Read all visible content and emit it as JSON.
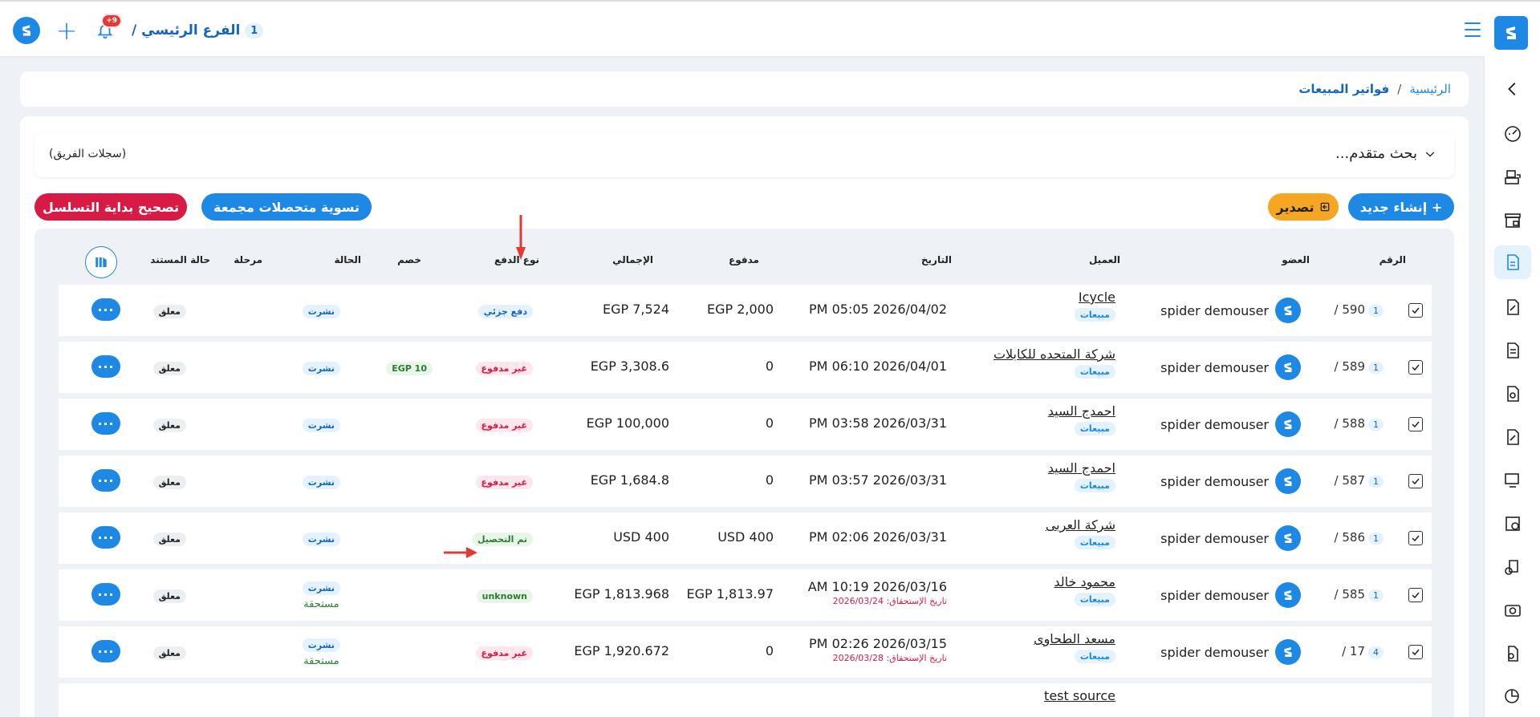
{
  "topbar": {
    "branch_name": "الفرع الرئيسي /",
    "branch_number": "1",
    "notif_count": "+9"
  },
  "breadcrumb": {
    "home": "الرئيسية",
    "separator": "/",
    "current": "فواتير المبيعات"
  },
  "search": {
    "advanced_label": "بحث متقدم...",
    "team_label": "(سجلات الفريق)"
  },
  "toolbar": {
    "create_label": "+ إنشاء جديد",
    "export_label": "تصدير",
    "settle_label": "تسوية متحصلات مجمعة",
    "fix_label": "تصحيح بداية التسلسل"
  },
  "columns": {
    "number": "الرقم",
    "member": "العضو",
    "client": "العميل",
    "date": "التاريخ",
    "paid": "مدفوع",
    "total": "الإجمالي",
    "payment_type": "نوع الدفع",
    "discount": "خصم",
    "status": "الحالة",
    "stage": "مرحلة",
    "doc_status": "حالة المستند"
  },
  "rows": [
    {
      "num": "590 /",
      "branch": "1",
      "member": "spider demouser",
      "client": "Icycle",
      "client_tag": "مبيعات",
      "date": "2026/04/02 05:05 PM",
      "due": "",
      "paid": "EGP 2,000",
      "total": "EGP 7,524",
      "pay_type": "دفع جزئي",
      "pay_class": "pill-partial",
      "discount": "",
      "status": "نشرت",
      "status_due": "",
      "doc_status": "معلق",
      "more": "···"
    },
    {
      "num": "589 /",
      "branch": "1",
      "member": "spider demouser",
      "client": "شركة المتحده للكابلات",
      "client_tag": "مبيعات",
      "date": "2026/04/01 06:10 PM",
      "due": "",
      "paid": "0",
      "total": "EGP 3,308.6",
      "pay_type": "غير مدفوع",
      "pay_class": "pill-unpaid",
      "discount": "EGP 10",
      "status": "نشرت",
      "status_due": "",
      "doc_status": "معلق",
      "more": "···"
    },
    {
      "num": "588 /",
      "branch": "1",
      "member": "spider demouser",
      "client": "احمدج السيد",
      "client_tag": "مبيعات",
      "date": "2026/03/31 03:58 PM",
      "due": "",
      "paid": "0",
      "total": "EGP 100,000",
      "pay_type": "غير مدفوع",
      "pay_class": "pill-unpaid",
      "discount": "",
      "status": "نشرت",
      "status_due": "",
      "doc_status": "معلق",
      "more": "···"
    },
    {
      "num": "587 /",
      "branch": "1",
      "member": "spider demouser",
      "client": "احمدج السيد",
      "client_tag": "مبيعات",
      "date": "2026/03/31 03:57 PM",
      "due": "",
      "paid": "0",
      "total": "EGP 1,684.8",
      "pay_type": "غير مدفوع",
      "pay_class": "pill-unpaid",
      "discount": "",
      "status": "نشرت",
      "status_due": "",
      "doc_status": "معلق",
      "more": "···"
    },
    {
      "num": "586 /",
      "branch": "1",
      "member": "spider demouser",
      "client": "شركة العربى",
      "client_tag": "مبيعات",
      "date": "2026/03/31 02:06 PM",
      "due": "",
      "paid": "USD 400",
      "total": "USD 400",
      "pay_type": "تم التحصيل",
      "pay_class": "pill-paid",
      "discount": "",
      "status": "نشرت",
      "status_due": "",
      "doc_status": "معلق",
      "more": "···"
    },
    {
      "num": "585 /",
      "branch": "1",
      "member": "spider demouser",
      "client": "محمود خالد",
      "client_tag": "مبيعات",
      "date": "2026/03/16 10:19 AM",
      "due": "تاريخ الإستحقاق: 2026/03/24",
      "paid": "EGP 1,813.97",
      "total": "EGP 1,813.968",
      "pay_type": "unknown",
      "pay_class": "pill-unknown",
      "discount": "",
      "status": "نشرت",
      "status_due": "مستحقة",
      "doc_status": "معلق",
      "more": "···"
    },
    {
      "num": "17 /",
      "branch": "4",
      "member": "spider demouser",
      "client": "مسعد الطحاوى",
      "client_tag": "مبيعات",
      "date": "2026/03/15 02:26 PM",
      "due": "تاريخ الإستحقاق: 2026/03/28",
      "paid": "0",
      "total": "EGP 1,920.672",
      "pay_type": "غير مدفوع",
      "pay_class": "pill-unpaid",
      "discount": "",
      "status": "نشرت",
      "status_due": "مستحقة",
      "doc_status": "معلق",
      "more": "···"
    }
  ],
  "partial_row": {
    "client": "test source"
  },
  "colors": {
    "primary": "#1e88e5",
    "danger": "#d81b45",
    "warning": "#f5a623",
    "success": "#2e7d32"
  }
}
